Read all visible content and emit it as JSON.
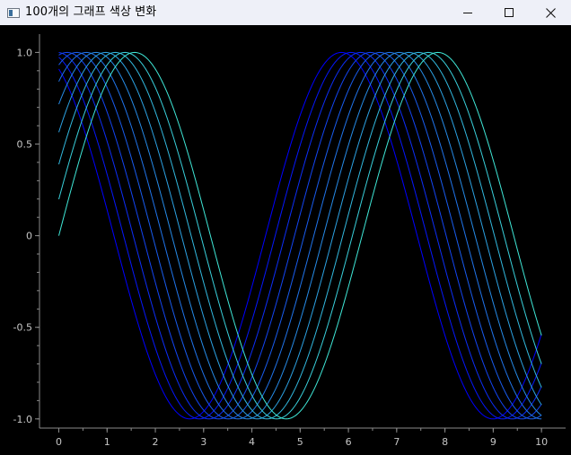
{
  "window": {
    "title": "100개의 그래프 색상 변화",
    "icons": {
      "app": "window-app-icon",
      "minimize": "minimize-icon",
      "maximize": "maximize-icon",
      "close": "close-icon"
    }
  },
  "chart_data": {
    "type": "line",
    "function": "sin(x + phase)",
    "x_range": [
      0,
      10
    ],
    "xlim": [
      -0.4,
      10.5
    ],
    "ylim": [
      -1.05,
      1.1
    ],
    "xticks": [
      0,
      1,
      2,
      3,
      4,
      5,
      6,
      7,
      8,
      9,
      10
    ],
    "yticks": [
      1.0,
      0.5,
      0,
      -0.5,
      -1.0
    ],
    "xtick_labels": [
      "0",
      "1",
      "2",
      "3",
      "4",
      "5",
      "6",
      "7",
      "8",
      "9",
      "10"
    ],
    "ytick_labels": [
      "1.0",
      "0.5",
      "0",
      "-0.5",
      "-1.0"
    ],
    "grid": false,
    "legend": "none",
    "series_count": 11,
    "phases": [
      0,
      0.2,
      0.4,
      0.6,
      0.8,
      1.0,
      1.2,
      1.4,
      1.6,
      1.8,
      2.0
    ],
    "colors": {
      "first": "#3fe7d7",
      "last": "#0000ff",
      "axis": "#8a8a8a",
      "text": "#c6c6c6"
    }
  }
}
